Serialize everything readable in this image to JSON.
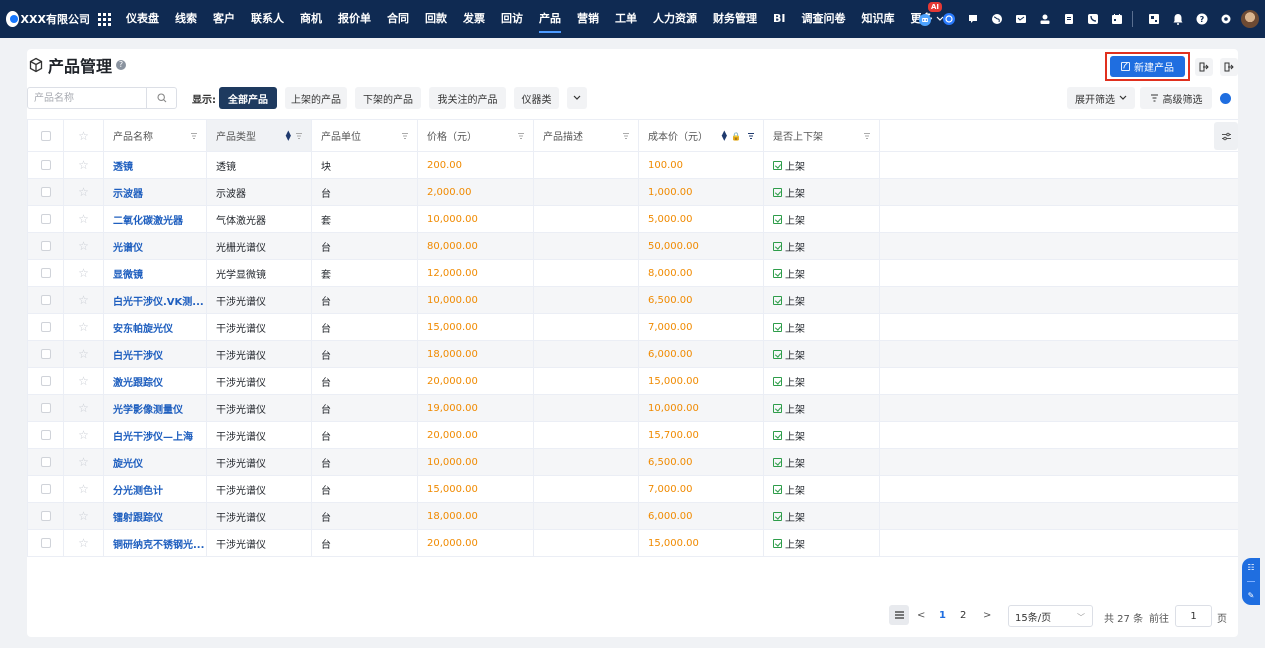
{
  "app": {
    "brand": "XXX有限公司",
    "colors": {
      "nav_bg": "#0f2a52",
      "primary": "#1f6ee0",
      "price": "#f08a00",
      "link": "#1f5fbf"
    }
  },
  "nav": {
    "items": [
      "仪表盘",
      "线索",
      "客户",
      "联系人",
      "商机",
      "报价单",
      "合同",
      "回款",
      "发票",
      "回访",
      "产品",
      "营销",
      "工单",
      "人力资源",
      "财务管理",
      "BI",
      "调查问卷",
      "知识库",
      "更多"
    ],
    "active": "产品",
    "ai_badge": "AI",
    "icons": [
      "robot-icon",
      "chat-icon",
      "message-icon",
      "globe-icon",
      "mail-icon",
      "user-icon",
      "document-icon",
      "phone-icon",
      "calendar-icon",
      "report-icon",
      "bell-icon",
      "help-icon",
      "gear-icon"
    ]
  },
  "page": {
    "title": "产品管理",
    "new_button": "新建产品"
  },
  "filters": {
    "search_placeholder": "产品名称",
    "show_label": "显示:",
    "chips": [
      "全部产品",
      "上架的产品",
      "下架的产品",
      "我关注的产品",
      "仪器类"
    ],
    "expand_filter": "展开筛选",
    "advanced_filter": "高级筛选"
  },
  "table": {
    "headers": {
      "name": "产品名称",
      "type": "产品类型",
      "unit": "产品单位",
      "price": "价格（元）",
      "desc": "产品描述",
      "cost": "成本价（元）",
      "shelf": "是否上下架"
    },
    "rows": [
      {
        "name": "透镜",
        "type": "透镜",
        "unit": "块",
        "price": "200.00",
        "desc": "",
        "cost": "100.00",
        "shelf": "上架"
      },
      {
        "name": "示波器",
        "type": "示波器",
        "unit": "台",
        "price": "2,000.00",
        "desc": "",
        "cost": "1,000.00",
        "shelf": "上架"
      },
      {
        "name": "二氧化碳激光器",
        "type": "气体激光器",
        "unit": "套",
        "price": "10,000.00",
        "desc": "",
        "cost": "5,000.00",
        "shelf": "上架"
      },
      {
        "name": "光谱仪",
        "type": "光栅光谱仪",
        "unit": "台",
        "price": "80,000.00",
        "desc": "",
        "cost": "50,000.00",
        "shelf": "上架"
      },
      {
        "name": "显微镜",
        "type": "光学显微镜",
        "unit": "套",
        "price": "12,000.00",
        "desc": "",
        "cost": "8,000.00",
        "shelf": "上架"
      },
      {
        "name": "白光干涉仪.VK测...",
        "type": "干涉光谱仪",
        "unit": "台",
        "price": "10,000.00",
        "desc": "",
        "cost": "6,500.00",
        "shelf": "上架"
      },
      {
        "name": "安东帕旋光仪",
        "type": "干涉光谱仪",
        "unit": "台",
        "price": "15,000.00",
        "desc": "",
        "cost": "7,000.00",
        "shelf": "上架"
      },
      {
        "name": "白光干涉仪",
        "type": "干涉光谱仪",
        "unit": "台",
        "price": "18,000.00",
        "desc": "",
        "cost": "6,000.00",
        "shelf": "上架"
      },
      {
        "name": "激光跟踪仪",
        "type": "干涉光谱仪",
        "unit": "台",
        "price": "20,000.00",
        "desc": "",
        "cost": "15,000.00",
        "shelf": "上架"
      },
      {
        "name": "光学影像测量仪",
        "type": "干涉光谱仪",
        "unit": "台",
        "price": "19,000.00",
        "desc": "",
        "cost": "10,000.00",
        "shelf": "上架"
      },
      {
        "name": "白光干涉仪—上海",
        "type": "干涉光谱仪",
        "unit": "台",
        "price": "20,000.00",
        "desc": "",
        "cost": "15,700.00",
        "shelf": "上架"
      },
      {
        "name": "旋光仪",
        "type": "干涉光谱仪",
        "unit": "台",
        "price": "10,000.00",
        "desc": "",
        "cost": "6,500.00",
        "shelf": "上架"
      },
      {
        "name": "分光测色计",
        "type": "干涉光谱仪",
        "unit": "台",
        "price": "15,000.00",
        "desc": "",
        "cost": "7,000.00",
        "shelf": "上架"
      },
      {
        "name": "镭射跟踪仪",
        "type": "干涉光谱仪",
        "unit": "台",
        "price": "18,000.00",
        "desc": "",
        "cost": "6,000.00",
        "shelf": "上架"
      },
      {
        "name": "铜研纳克不锈钢光...",
        "type": "干涉光谱仪",
        "unit": "台",
        "price": "20,000.00",
        "desc": "",
        "cost": "15,000.00",
        "shelf": "上架"
      }
    ]
  },
  "pagination": {
    "pages": [
      "1",
      "2"
    ],
    "current": "1",
    "page_size": "15条/页",
    "total": "共 27 条",
    "goto_label": "前往",
    "goto_value": "1",
    "page_unit": "页"
  }
}
